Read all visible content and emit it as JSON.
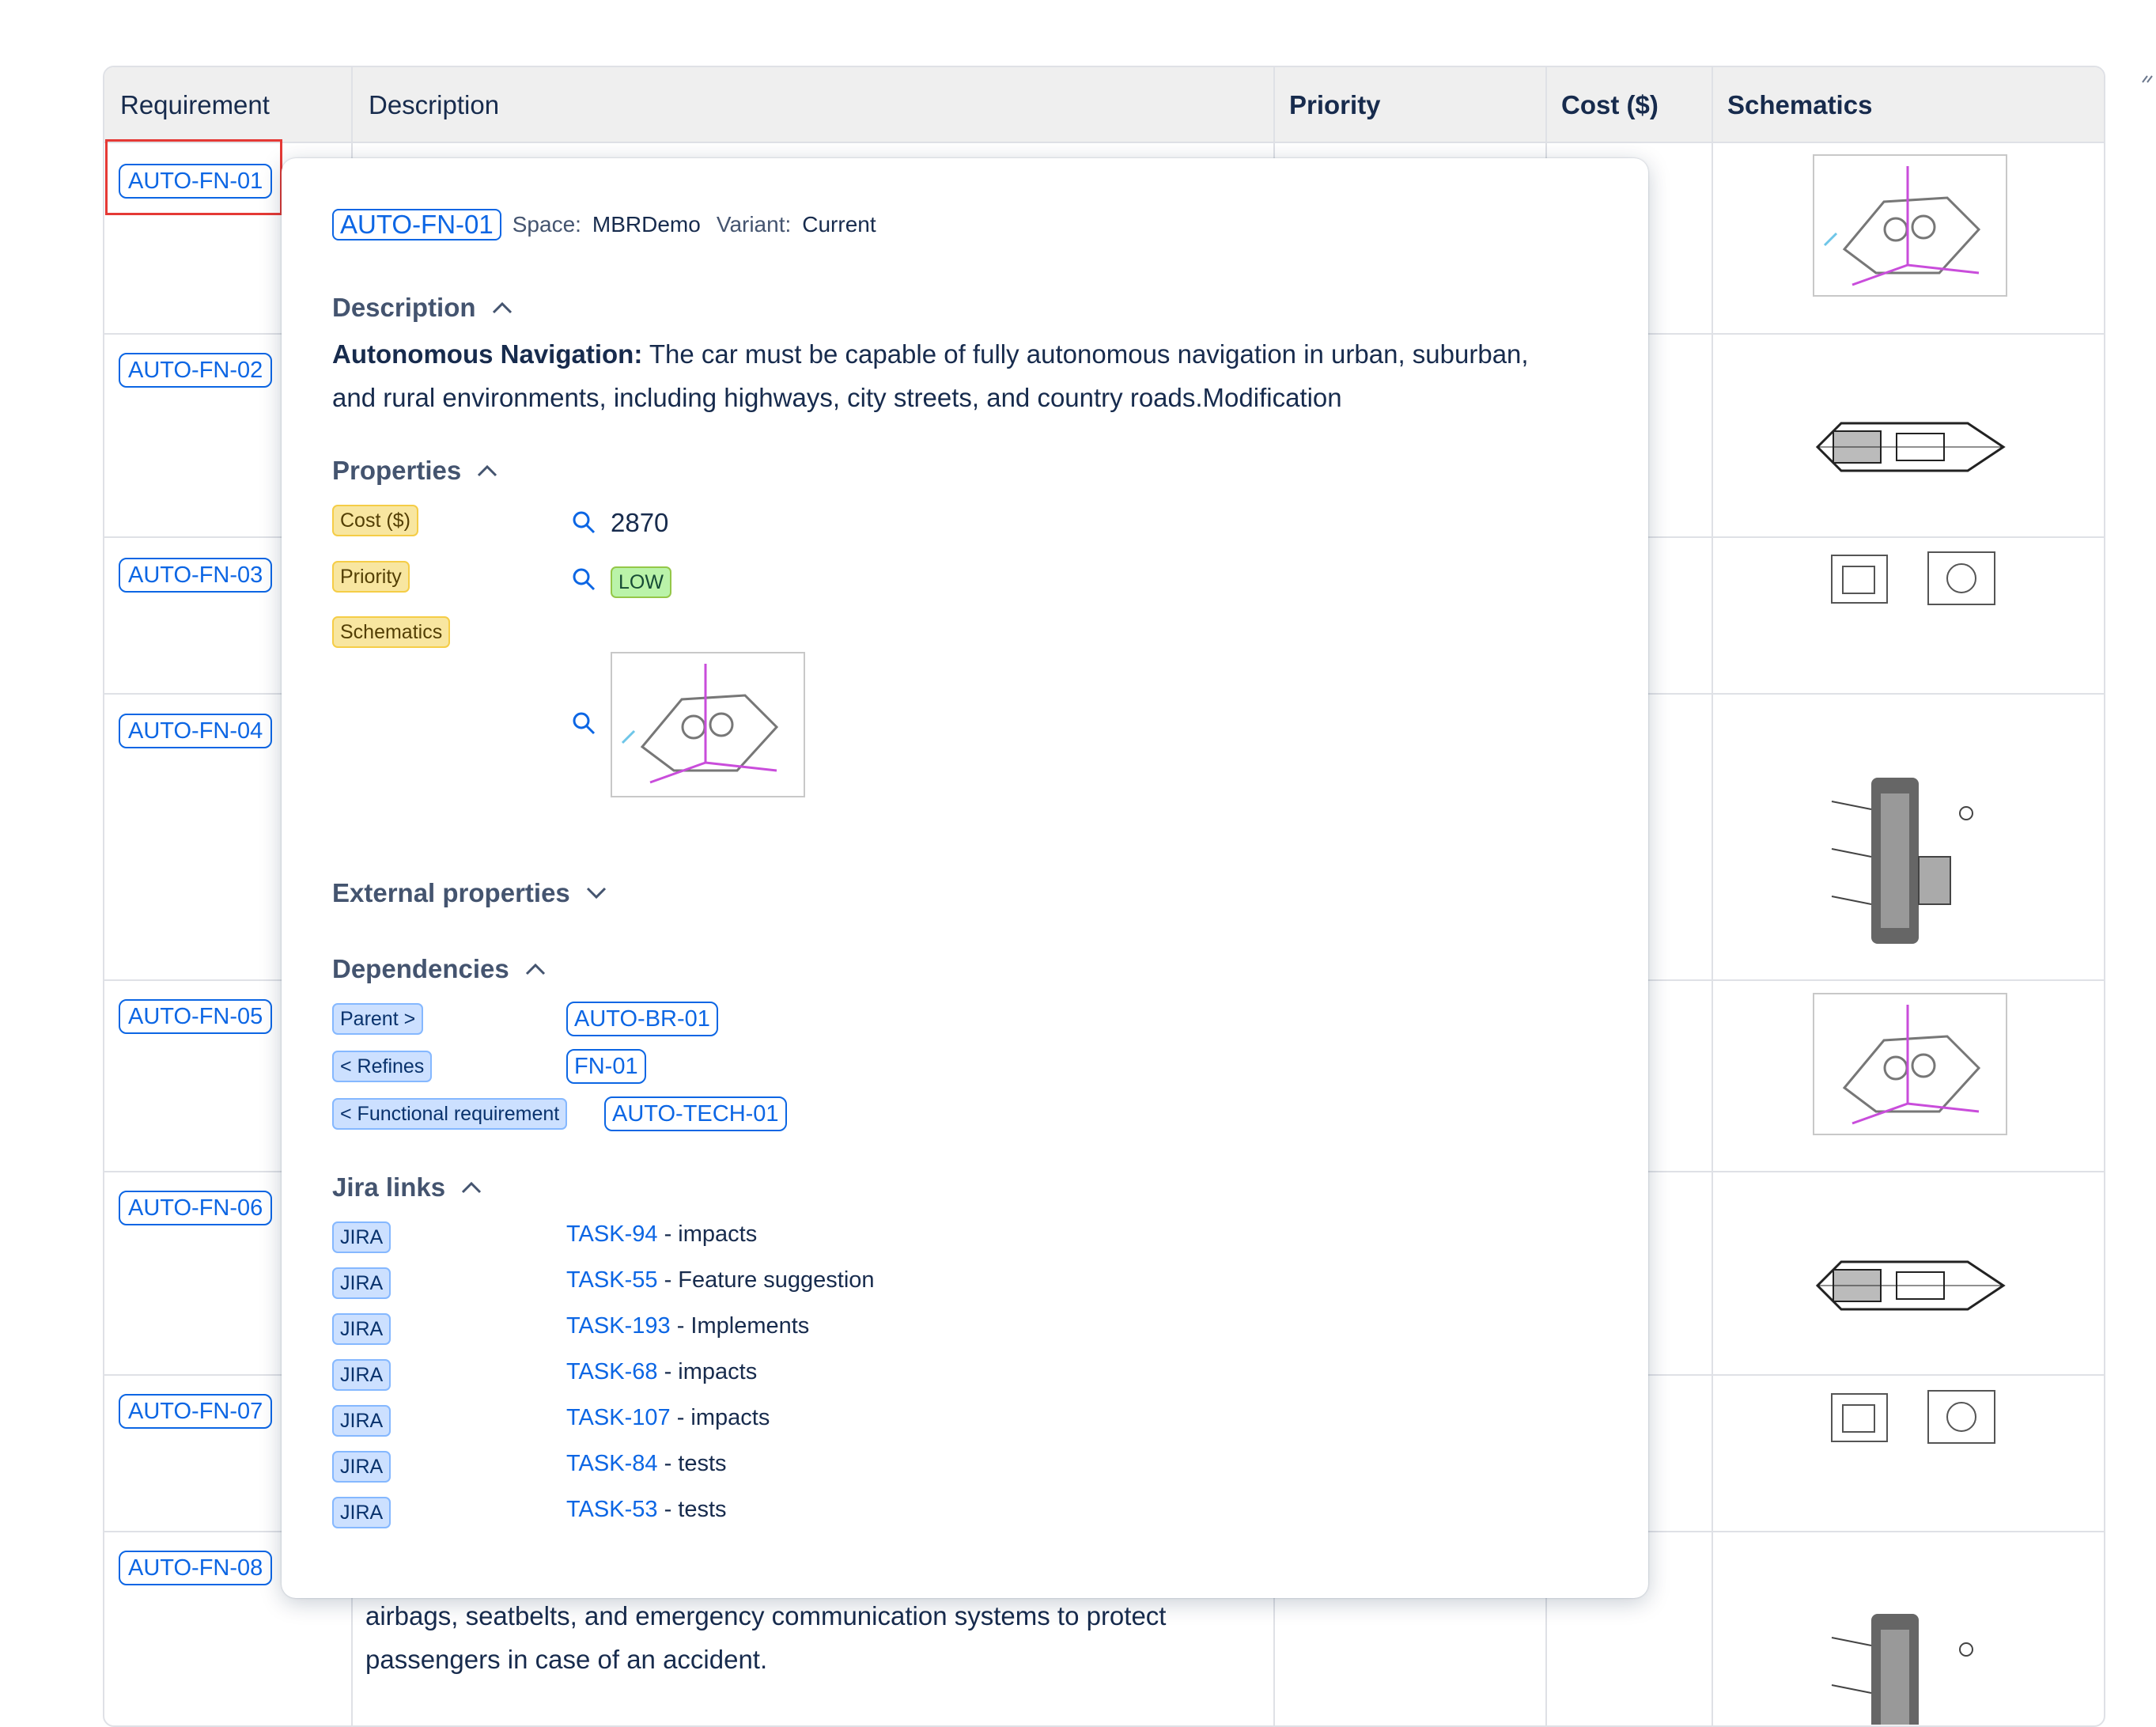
{
  "table": {
    "headers": [
      "Requirement",
      "Description",
      "Priority",
      "Cost ($)",
      "Schematics"
    ],
    "rows": [
      {
        "key": "AUTO-FN-01",
        "schematic": "engine-block-diagram"
      },
      {
        "key": "AUTO-FN-02",
        "schematic": "turbine-engine-diagram"
      },
      {
        "key": "AUTO-FN-03",
        "schematic": "piston-technical-drawing"
      },
      {
        "key": "AUTO-FN-04",
        "schematic": "mr-fluid-damper-diagram"
      },
      {
        "key": "AUTO-FN-05",
        "schematic": "engine-block-diagram"
      },
      {
        "key": "AUTO-FN-06",
        "schematic": "turbine-engine-diagram"
      },
      {
        "key": "AUTO-FN-07",
        "schematic": "piston-technical-drawing"
      },
      {
        "key": "AUTO-FN-08",
        "schematic": "mr-fluid-damper-diagram"
      }
    ],
    "row8_description": "airbags, seatbelts, and emergency communication systems to protect passengers in case of an accident."
  },
  "popup": {
    "key": "AUTO-FN-01",
    "space_label": "Space:",
    "space_value": "MBRDemo",
    "variant_label": "Variant:",
    "variant_value": "Current",
    "description_heading": "Description",
    "description_title": "Autonomous Navigation:",
    "description_body": " The car must be capable of fully autonomous navigation in urban, suburban, and rural environments, including highways, city streets, and country roads.Modification",
    "properties_heading": "Properties",
    "properties": {
      "cost_label": "Cost ($)",
      "cost_value": "2870",
      "priority_label": "Priority",
      "priority_value": "LOW",
      "schematics_label": "Schematics",
      "schematics_value": "engine-block-diagram"
    },
    "external_heading": "External properties",
    "dependencies_heading": "Dependencies",
    "dependencies": [
      {
        "type": "Parent >",
        "target": "AUTO-BR-01"
      },
      {
        "type": "< Refines",
        "target": "FN-01"
      },
      {
        "type": "< Functional requirement",
        "target": "AUTO-TECH-01"
      }
    ],
    "jira_heading": "Jira links",
    "jira_badge": "JIRA",
    "jira": [
      {
        "task": "TASK-94",
        "rel": " - impacts"
      },
      {
        "task": "TASK-55",
        "rel": " - Feature suggestion"
      },
      {
        "task": "TASK-193",
        "rel": " - Implements"
      },
      {
        "task": "TASK-68",
        "rel": " - impacts"
      },
      {
        "task": "TASK-107",
        "rel": " - impacts"
      },
      {
        "task": "TASK-84",
        "rel": " - tests"
      },
      {
        "task": "TASK-53",
        "rel": " - tests"
      }
    ]
  },
  "colors": {
    "link_blue": "#0c66e4",
    "focus_red": "#e53935",
    "header_gray": "#efefef"
  }
}
